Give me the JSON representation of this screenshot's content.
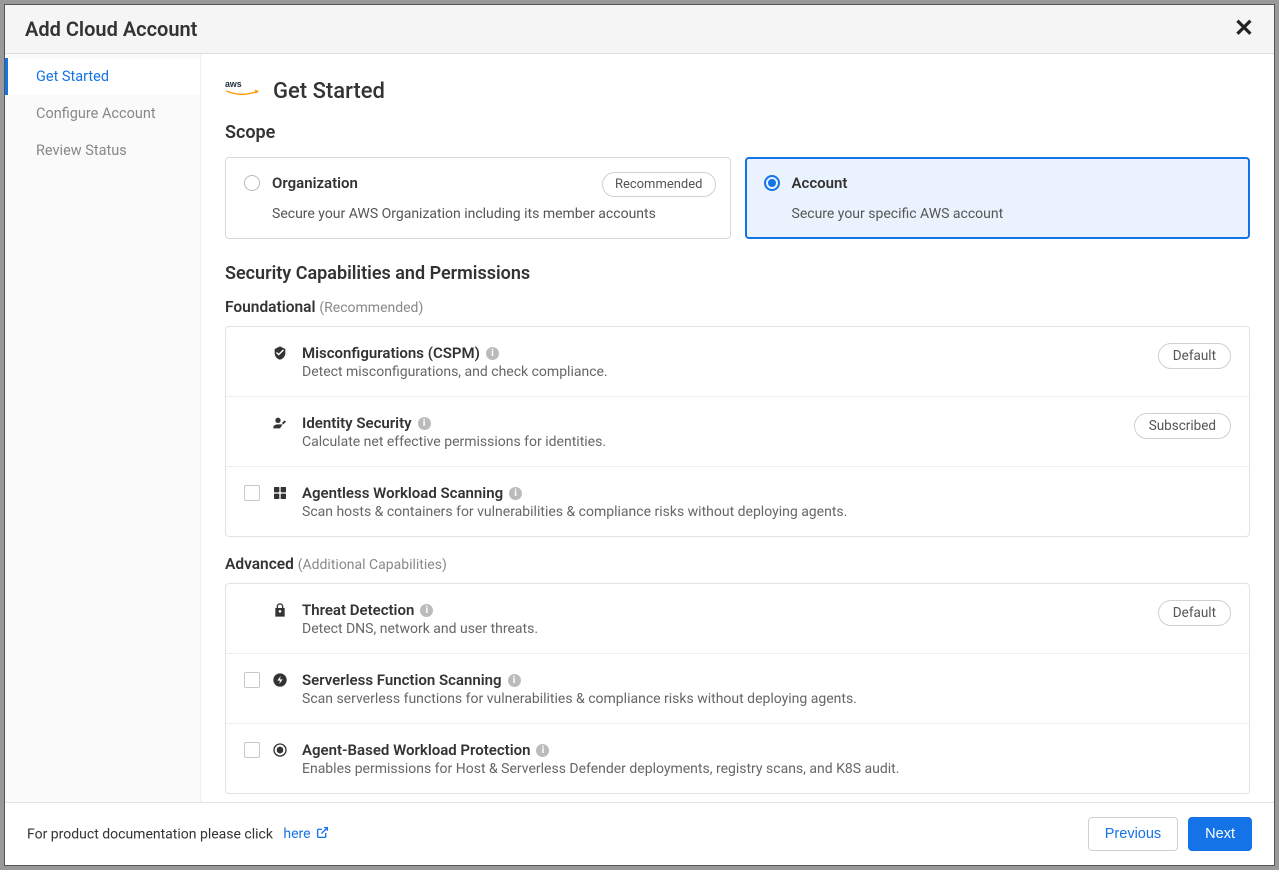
{
  "modal_title": "Add Cloud Account",
  "sidebar": {
    "items": [
      {
        "label": "Get Started",
        "active": true
      },
      {
        "label": "Configure Account",
        "active": false
      },
      {
        "label": "Review Status",
        "active": false
      }
    ]
  },
  "page": {
    "provider": "aws",
    "title": "Get Started",
    "scope_title": "Scope",
    "capabilities_title": "Security Capabilities and Permissions",
    "foundational_label": "Foundational",
    "foundational_sublabel": "(Recommended)",
    "advanced_label": "Advanced",
    "advanced_sublabel": "(Additional Capabilities)"
  },
  "scope": {
    "organization": {
      "name": "Organization",
      "desc": "Secure your AWS Organization including its member accounts",
      "badge": "Recommended",
      "selected": false
    },
    "account": {
      "name": "Account",
      "desc": "Secure your specific AWS account",
      "selected": true
    }
  },
  "foundational_capabilities": [
    {
      "icon": "cspm",
      "title": "Misconfigurations (CSPM)",
      "desc": "Detect misconfigurations, and check compliance.",
      "badge": "Default",
      "checkbox": false
    },
    {
      "icon": "identity",
      "title": "Identity Security",
      "desc": "Calculate net effective permissions for identities.",
      "badge": "Subscribed",
      "checkbox": false
    },
    {
      "icon": "workload",
      "title": "Agentless Workload Scanning",
      "desc": "Scan hosts & containers for vulnerabilities & compliance risks without deploying agents.",
      "badge": null,
      "checkbox": true
    }
  ],
  "advanced_capabilities": [
    {
      "icon": "threat",
      "title": "Threat Detection",
      "desc": "Detect DNS, network and user threats.",
      "badge": "Default",
      "checkbox": false
    },
    {
      "icon": "serverless",
      "title": "Serverless Function Scanning",
      "desc": "Scan serverless functions for vulnerabilities & compliance risks without deploying agents.",
      "badge": null,
      "checkbox": true
    },
    {
      "icon": "agent",
      "title": "Agent-Based Workload Protection",
      "desc": "Enables permissions for Host & Serverless Defender deployments, registry scans, and K8S audit.",
      "badge": null,
      "checkbox": true
    }
  ],
  "footer": {
    "doc_text": "For product documentation please click",
    "doc_link": "here",
    "previous": "Previous",
    "next": "Next"
  }
}
